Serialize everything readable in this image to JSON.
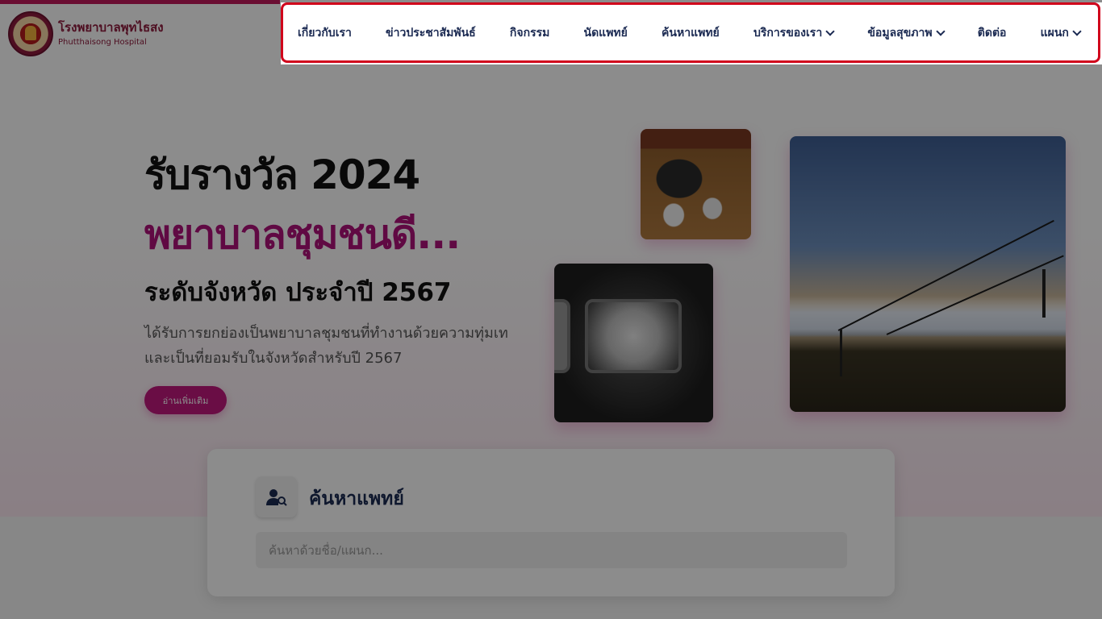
{
  "brand": {
    "name_th": "โรงพยาบาลพุทไธสง",
    "name_en": "Phutthaisong Hospital"
  },
  "nav": {
    "items": [
      {
        "label": "เกี่ยวกับเรา",
        "dropdown": false
      },
      {
        "label": "ข่าวประชาสัมพันธ์",
        "dropdown": false
      },
      {
        "label": "กิจกรรม",
        "dropdown": false
      },
      {
        "label": "นัดแพทย์",
        "dropdown": false
      },
      {
        "label": "ค้นหาแพทย์",
        "dropdown": false
      },
      {
        "label": "บริการของเรา",
        "dropdown": true
      },
      {
        "label": "ข้อมูลสุขภาพ",
        "dropdown": true
      },
      {
        "label": "ติดต่อ",
        "dropdown": false
      },
      {
        "label": "แผนก",
        "dropdown": true
      }
    ]
  },
  "hero": {
    "line1": "รับรางวัล 2024",
    "line2": "พยาบาลชุมชนดี...",
    "line3": "ระดับจังหวัด ประจำปี 2567",
    "description": "ได้รับการยกย่องเป็นพยาบาลชุมชนที่ทำงานด้วยความทุ่มเทและเป็นที่ยอมรับในจังหวัดสำหรับปี 2567",
    "button_label": "อ่านเพิ่มเติม"
  },
  "search": {
    "title": "ค้นหาแพทย์",
    "placeholder": "ค้นหาด้วยชื่อ/แผนก..."
  },
  "colors": {
    "accent": "#c2187f",
    "brand": "#8e1b3c",
    "nav_text": "#1b2a52",
    "highlight_border": "#d0021b"
  }
}
